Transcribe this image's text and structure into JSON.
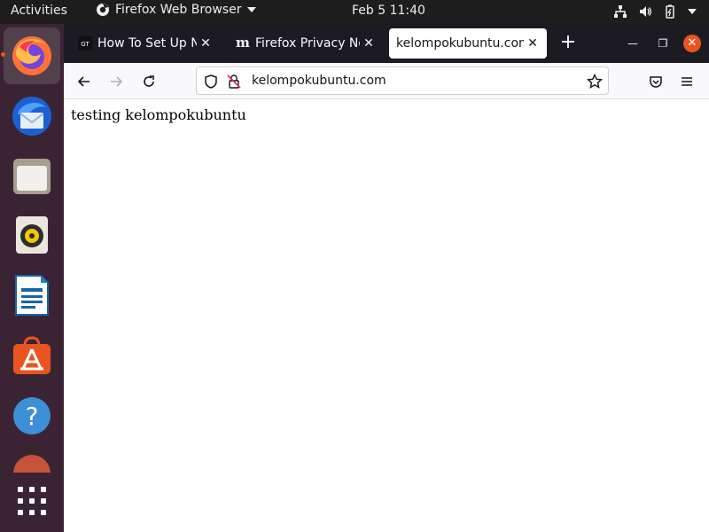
{
  "topbar": {
    "activities": "Activities",
    "app_name": "Firefox Web Browser",
    "clock": "Feb 5  11:40",
    "tray_icons": [
      "network-icon",
      "volume-icon",
      "battery-icon",
      "system-menu-caret"
    ]
  },
  "dock": {
    "items": [
      "firefox",
      "thunderbird",
      "files",
      "rhythmbox",
      "libreoffice-writer",
      "ubuntu-software",
      "help",
      "partially-visible-app",
      "show-applications"
    ],
    "accent": "#e95420"
  },
  "browser": {
    "tabs": [
      {
        "title": "How To Set Up NGI",
        "favicon_text": "GT"
      },
      {
        "title": "Firefox Privacy No",
        "favicon_text": "m"
      },
      {
        "title": "kelompokubuntu.com/",
        "selected": true
      }
    ],
    "url": "kelompokubuntu.com",
    "page_text": "testing kelompokubuntu"
  }
}
